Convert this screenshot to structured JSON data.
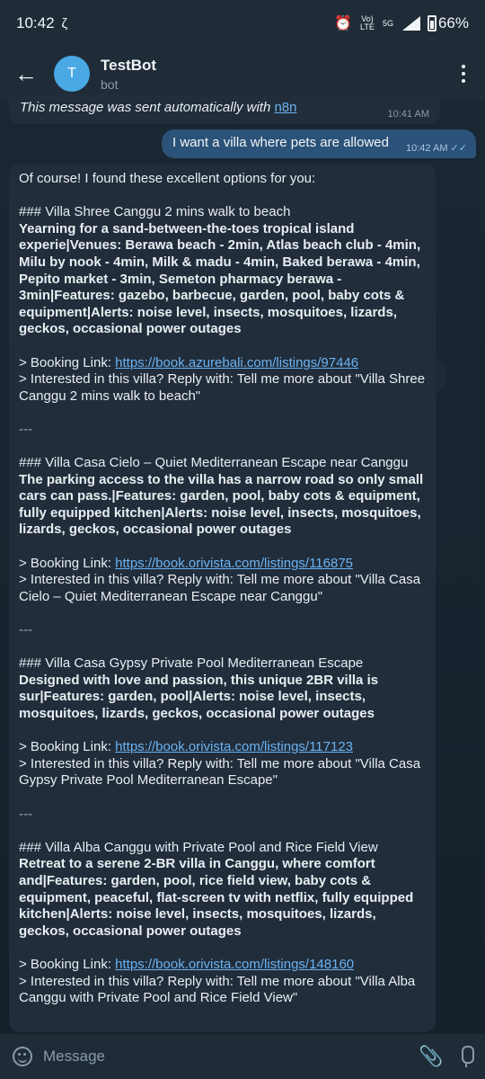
{
  "status": {
    "time": "10:42",
    "volte": "Vo) LTE",
    "network": "5G",
    "battery": "66%"
  },
  "header": {
    "avatar_letter": "T",
    "title": "TestBot",
    "subtitle": "bot"
  },
  "top_message": {
    "text": "This message was sent automatically with ",
    "link": "n8n",
    "time": "10:41 AM"
  },
  "outgoing": {
    "text": "I want a villa where pets are allowed",
    "time": "10:42 AM"
  },
  "reply": {
    "intro": "Of course! I found these excellent options for you:",
    "villas": [
      {
        "heading": "### Villa Shree Canggu 2 mins walk to beach",
        "details": "Yearning for a sand-between-the-toes tropical island experie|Venues: Berawa beach - 2min, Atlas beach club - 4min, Milu by nook - 4min, Milk & madu - 4min, Baked berawa - 4min, Pepito market - 3min, Semeton pharmacy berawa - 3min|Features: gazebo, barbecue, garden, pool, baby cots & equipment|Alerts: noise level, insects, mosquitoes, lizards, geckos, occasional power outages",
        "booking_prefix": "> Booking Link: ",
        "booking_link": "https://book.azurebali.com/listings/97446",
        "interest": "> Interested in this villa? Reply with: Tell me more about \"Villa Shree Canggu 2 mins walk to beach\""
      },
      {
        "heading": "### Villa Casa Cielo – Quiet Mediterranean Escape near Canggu",
        "details": "The parking access to the villa has a narrow road so only small cars can pass.|Features: garden, pool, baby cots & equipment, fully equipped kitchen|Alerts: noise level, insects, mosquitoes, lizards, geckos, occasional power outages",
        "booking_prefix": "> Booking Link: ",
        "booking_link": "https://book.orivista.com/listings/116875",
        "interest": "> Interested in this villa? Reply with: Tell me more about \"Villa Casa Cielo – Quiet Mediterranean Escape near Canggu\""
      },
      {
        "heading": "### Villa Casa Gypsy Private Pool Mediterranean Escape",
        "details": "Designed with love and passion, this unique 2BR villa is sur|Features: garden, pool|Alerts: noise level, insects, mosquitoes, lizards, geckos, occasional power outages",
        "booking_prefix": "> Booking Link: ",
        "booking_link": "https://book.orivista.com/listings/117123",
        "interest": "> Interested in this villa? Reply with: Tell me more about \"Villa Casa Gypsy Private Pool Mediterranean Escape\""
      },
      {
        "heading": "### Villa Alba Canggu with Private Pool and Rice Field View",
        "details": "Retreat to a serene 2-BR villa in Canggu, where comfort and|Features: garden, pool, rice field view, baby cots & equipment, peaceful, flat-screen tv with netflix, fully equipped kitchen|Alerts: noise level, insects, mosquitoes, lizards, geckos, occasional power outages",
        "booking_prefix": "> Booking Link: ",
        "booking_link": "https://book.orivista.com/listings/148160",
        "interest": "> Interested in this villa? Reply with: Tell me more about \"Villa Alba Canggu with Private Pool and Rice Field View\""
      }
    ],
    "separator": "---"
  },
  "input": {
    "placeholder": "Message"
  },
  "icons": {
    "back": "arrow-left-icon",
    "menu": "more-vert-icon",
    "emoji": "emoji-icon",
    "attach": "paperclip-icon",
    "mic": "microphone-icon",
    "alarm": "alarm-icon"
  }
}
